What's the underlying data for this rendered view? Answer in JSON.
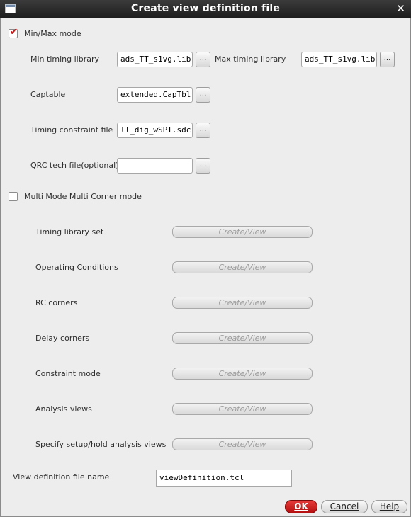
{
  "window": {
    "title": "Create view definition file",
    "close_glyph": "✕",
    "icon": "window-icon"
  },
  "minmax": {
    "checked": true,
    "label": "Min/Max mode",
    "min_timing_label": "Min timing library",
    "min_timing_value": "ads_TT_s1vg.lib",
    "max_timing_label": "Max timing library",
    "max_timing_value": "ads_TT_s1vg.lib",
    "captable_label": "Captable",
    "captable_value": "extended.CapTbl",
    "constraint_label": "Timing constraint file",
    "constraint_value": "ll_dig_wSPI.sdc",
    "qrc_label": "QRC tech file(optional)",
    "qrc_value": "",
    "browse_label": "..."
  },
  "mmmc": {
    "checked": false,
    "label": "Multi Mode Multi Corner mode",
    "rows": [
      {
        "label": "Timing library set",
        "button": "Create/View"
      },
      {
        "label": "Operating Conditions",
        "button": "Create/View"
      },
      {
        "label": "RC corners",
        "button": "Create/View"
      },
      {
        "label": "Delay corners",
        "button": "Create/View"
      },
      {
        "label": "Constraint mode",
        "button": "Create/View"
      },
      {
        "label": "Analysis views",
        "button": "Create/View"
      },
      {
        "label": "Specify setup/hold analysis views",
        "button": "Create/View"
      }
    ]
  },
  "viewdef": {
    "label": "View definition file name",
    "value": "viewDefinition.tcl"
  },
  "buttons": {
    "ok": "OK",
    "cancel": "Cancel",
    "help": "Help"
  },
  "colors": {
    "titlebar": "#2a2a2a",
    "ok_button": "#d11f1f",
    "checkmark": "#c41515"
  }
}
